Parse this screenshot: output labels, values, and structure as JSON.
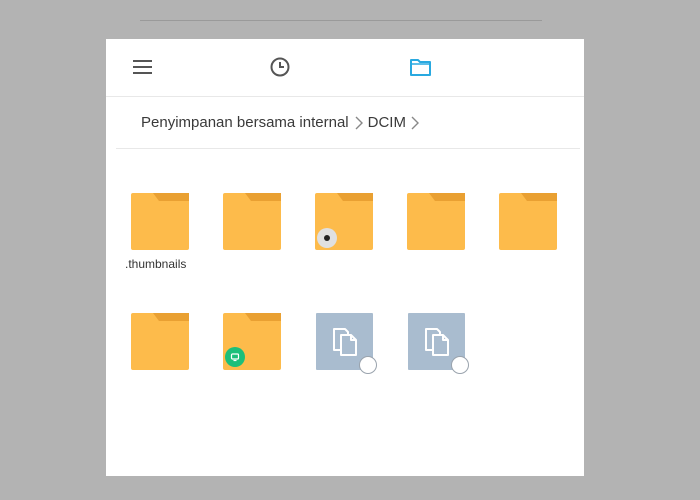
{
  "window": {
    "accent_color": "#29a9e0",
    "folder_color": "#fdbb4b",
    "file_tile_color": "#a9bccf"
  },
  "toolbar": {
    "buttons": [
      {
        "icon": "menu-icon"
      },
      {
        "icon": "clock-icon"
      },
      {
        "icon": "folder-icon",
        "active": true
      }
    ]
  },
  "breadcrumb": {
    "items": [
      {
        "label": "Penyimpanan bersama internal"
      },
      {
        "label": "DCIM"
      }
    ]
  },
  "grid": {
    "items": [
      {
        "type": "folder",
        "label": ".thumbnails"
      },
      {
        "type": "folder",
        "label": ""
      },
      {
        "type": "folder",
        "label": "",
        "badge": "disc-icon"
      },
      {
        "type": "folder",
        "label": ""
      },
      {
        "type": "folder",
        "label": ""
      },
      {
        "type": "folder",
        "label": ""
      },
      {
        "type": "folder",
        "label": "",
        "badge": "app-icon"
      },
      {
        "type": "file",
        "label": "",
        "selectable": true
      },
      {
        "type": "file",
        "label": "",
        "selectable": true
      }
    ]
  }
}
